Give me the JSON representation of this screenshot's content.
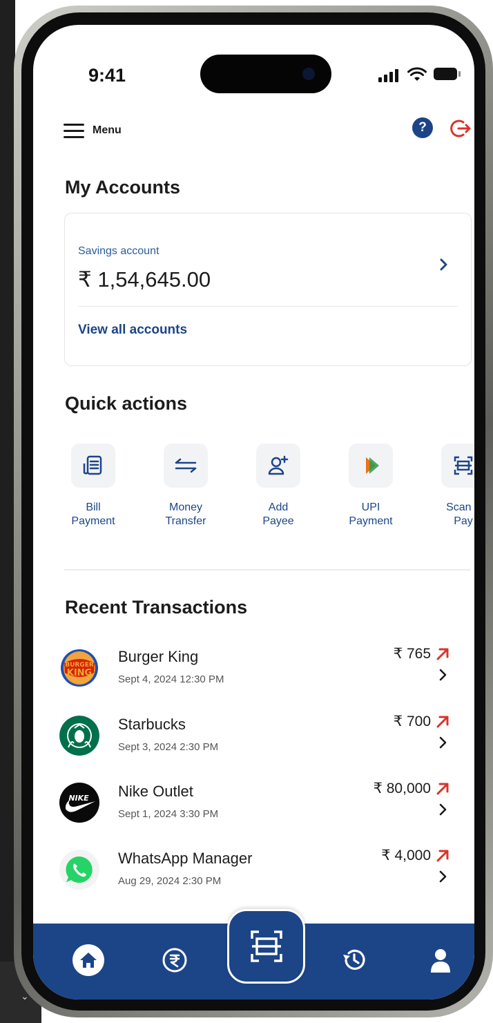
{
  "status_bar": {
    "time": "9:41"
  },
  "header": {
    "menu_label": "Menu"
  },
  "accounts": {
    "heading": "My Accounts",
    "account_type": "Savings account",
    "balance": "₹ 1,54,645.00",
    "view_all_label": "View all accounts"
  },
  "quick_actions": {
    "heading": "Quick actions",
    "items": [
      {
        "label": "Bill\nPayment",
        "icon": "bill-icon"
      },
      {
        "label": "Money\nTransfer",
        "icon": "transfer-arrows-icon"
      },
      {
        "label": "Add\nPayee",
        "icon": "add-user-icon"
      },
      {
        "label": "UPI\nPayment",
        "icon": "upi-logo-icon"
      },
      {
        "label": "Scan a\nPay",
        "icon": "scan-icon"
      }
    ]
  },
  "transactions": {
    "heading": "Recent Transactions",
    "items": [
      {
        "merchant": "Burger King",
        "datetime": "Sept 4, 2024 12:30 PM",
        "amount": "₹ 765",
        "logo": "burger-king-logo",
        "direction": "outgoing"
      },
      {
        "merchant": "Starbucks",
        "datetime": "Sept 3, 2024 2:30 PM",
        "amount": "₹ 700",
        "logo": "starbucks-logo",
        "direction": "outgoing"
      },
      {
        "merchant": "Nike Outlet",
        "datetime": "Sept 1, 2024 3:30 PM",
        "amount": "₹ 80,000",
        "logo": "nike-logo",
        "direction": "outgoing"
      },
      {
        "merchant": "WhatsApp Manager",
        "datetime": "Aug 29, 2024 2:30 PM",
        "amount": "₹ 4,000",
        "logo": "whatsapp-logo",
        "direction": "outgoing"
      }
    ]
  },
  "bottom_nav": {
    "items": [
      "home-icon",
      "rupee-icon",
      "scan-icon",
      "history-icon",
      "profile-icon"
    ]
  },
  "colors": {
    "brand": "#1c4588",
    "debit_arrow": "#d9342b",
    "logout": "#d9342b"
  }
}
